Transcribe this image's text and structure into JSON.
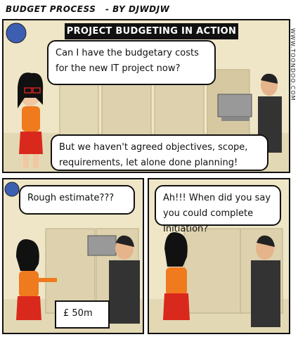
{
  "header": {
    "series_title": "BUDGET PROCESS",
    "author": "- BY DJWDJW"
  },
  "title_bar": "PROJECT BUDGETING IN ACTION",
  "credit": "WWW.TOONDOO.COM",
  "panels": {
    "panel1": {
      "bubble_woman": "Can I have the budgetary costs for the new IT project now?",
      "bubble_man": "But we haven't agreed objectives, scope, requirements, let alone done planning!"
    },
    "panel2": {
      "bubble_woman": "Rough estimate???",
      "bubble_man": "£ 50m"
    },
    "panel3": {
      "bubble_woman": "Ah!!! When did you say you could complete Initiation?"
    }
  },
  "colors": {
    "office_wall": "#efe6c8",
    "cubicle": "#ddd2ad",
    "woman_top": "#f07a1e",
    "woman_skirt": "#d9281c",
    "man_suit": "#333333"
  }
}
